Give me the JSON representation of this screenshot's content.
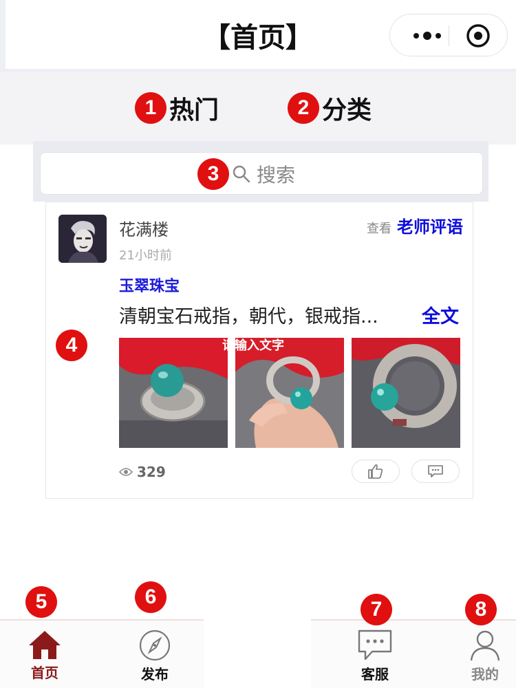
{
  "header": {
    "title": "【首页】",
    "capsule_icons": [
      "more-dots-icon",
      "target-icon"
    ]
  },
  "tabs": [
    {
      "badge": "1",
      "label": "热门"
    },
    {
      "badge": "2",
      "label": "分类"
    }
  ],
  "search": {
    "badge": "3",
    "placeholder": "搜索",
    "icon": "search-icon"
  },
  "post": {
    "badge": "4",
    "author": "花满楼",
    "time": "21小时前",
    "review_prefix": "查看",
    "review_link": "老师评语",
    "tag": "玉翠珠宝",
    "excerpt": "清朝宝石戒指，朝代，银戒指...",
    "full_text_link": "全文",
    "image_overlay_text": "请输入文字",
    "views": "329",
    "like_icon": "thumbs-up-icon",
    "comment_icon": "comment-icon"
  },
  "bottom_nav": [
    {
      "badge": "5",
      "label": "首页",
      "icon": "home-icon",
      "active": true
    },
    {
      "badge": "6",
      "label": "发布",
      "icon": "compass-icon"
    },
    {
      "badge": "7",
      "label": "客服",
      "icon": "chat-icon"
    },
    {
      "badge": "8",
      "label": "我的",
      "icon": "user-icon"
    }
  ],
  "colors": {
    "accent": "#e01010",
    "link": "#0d0ddd",
    "nav_active": "#8b1a1a"
  }
}
